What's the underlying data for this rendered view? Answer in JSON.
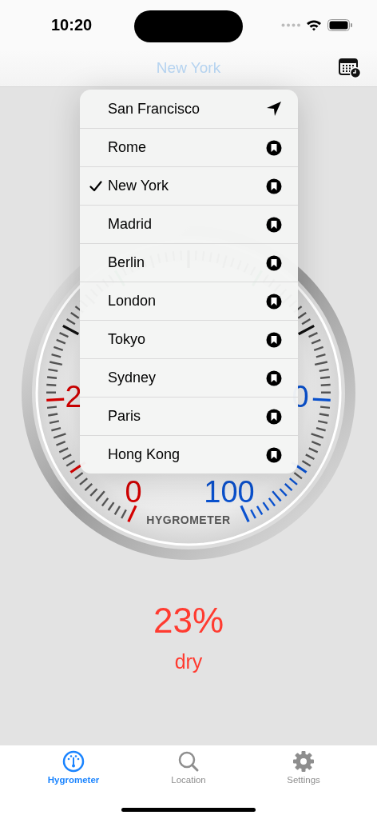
{
  "status_bar": {
    "time": "10:20"
  },
  "nav_bar": {
    "title": "New York"
  },
  "gauge": {
    "title": "HYGROMETER",
    "labels": [
      {
        "text": "2",
        "color": "#d40000"
      },
      {
        "text": "0",
        "color": "#0a52d0"
      },
      {
        "text": "0",
        "color": "#d40000"
      },
      {
        "text": "100",
        "color": "#0a52d0"
      }
    ]
  },
  "location_menu": {
    "items": [
      {
        "name": "San Francisco",
        "kind": "current",
        "selected": false
      },
      {
        "name": "Rome",
        "kind": "saved",
        "selected": false
      },
      {
        "name": "New York",
        "kind": "saved",
        "selected": true
      },
      {
        "name": "Madrid",
        "kind": "saved",
        "selected": false
      },
      {
        "name": "Berlin",
        "kind": "saved",
        "selected": false
      },
      {
        "name": "London",
        "kind": "saved",
        "selected": false
      },
      {
        "name": "Tokyo",
        "kind": "saved",
        "selected": false
      },
      {
        "name": "Sydney",
        "kind": "saved",
        "selected": false
      },
      {
        "name": "Paris",
        "kind": "saved",
        "selected": false
      },
      {
        "name": "Hong Kong",
        "kind": "saved",
        "selected": false
      }
    ]
  },
  "reading": {
    "value": "23%",
    "condition": "dry"
  },
  "tabs": [
    {
      "label": "Hygrometer",
      "kind": "gauge",
      "selected": true
    },
    {
      "label": "Location",
      "kind": "search",
      "selected": false
    },
    {
      "label": "Settings",
      "kind": "settings",
      "selected": false
    }
  ]
}
